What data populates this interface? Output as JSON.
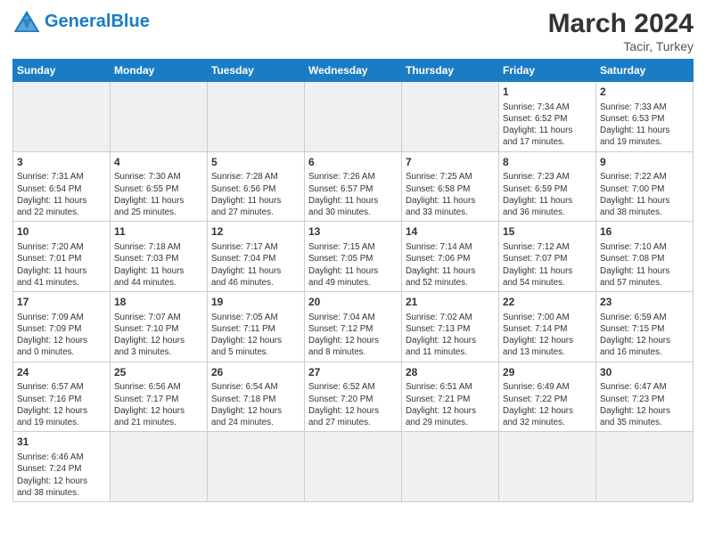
{
  "header": {
    "logo_general": "General",
    "logo_blue": "Blue",
    "month_year": "March 2024",
    "location": "Tacir, Turkey"
  },
  "weekdays": [
    "Sunday",
    "Monday",
    "Tuesday",
    "Wednesday",
    "Thursday",
    "Friday",
    "Saturday"
  ],
  "weeks": [
    [
      {
        "day": "",
        "info": ""
      },
      {
        "day": "",
        "info": ""
      },
      {
        "day": "",
        "info": ""
      },
      {
        "day": "",
        "info": ""
      },
      {
        "day": "",
        "info": ""
      },
      {
        "day": "1",
        "info": "Sunrise: 7:34 AM\nSunset: 6:52 PM\nDaylight: 11 hours\nand 17 minutes."
      },
      {
        "day": "2",
        "info": "Sunrise: 7:33 AM\nSunset: 6:53 PM\nDaylight: 11 hours\nand 19 minutes."
      }
    ],
    [
      {
        "day": "3",
        "info": "Sunrise: 7:31 AM\nSunset: 6:54 PM\nDaylight: 11 hours\nand 22 minutes."
      },
      {
        "day": "4",
        "info": "Sunrise: 7:30 AM\nSunset: 6:55 PM\nDaylight: 11 hours\nand 25 minutes."
      },
      {
        "day": "5",
        "info": "Sunrise: 7:28 AM\nSunset: 6:56 PM\nDaylight: 11 hours\nand 27 minutes."
      },
      {
        "day": "6",
        "info": "Sunrise: 7:26 AM\nSunset: 6:57 PM\nDaylight: 11 hours\nand 30 minutes."
      },
      {
        "day": "7",
        "info": "Sunrise: 7:25 AM\nSunset: 6:58 PM\nDaylight: 11 hours\nand 33 minutes."
      },
      {
        "day": "8",
        "info": "Sunrise: 7:23 AM\nSunset: 6:59 PM\nDaylight: 11 hours\nand 36 minutes."
      },
      {
        "day": "9",
        "info": "Sunrise: 7:22 AM\nSunset: 7:00 PM\nDaylight: 11 hours\nand 38 minutes."
      }
    ],
    [
      {
        "day": "10",
        "info": "Sunrise: 7:20 AM\nSunset: 7:01 PM\nDaylight: 11 hours\nand 41 minutes."
      },
      {
        "day": "11",
        "info": "Sunrise: 7:18 AM\nSunset: 7:03 PM\nDaylight: 11 hours\nand 44 minutes."
      },
      {
        "day": "12",
        "info": "Sunrise: 7:17 AM\nSunset: 7:04 PM\nDaylight: 11 hours\nand 46 minutes."
      },
      {
        "day": "13",
        "info": "Sunrise: 7:15 AM\nSunset: 7:05 PM\nDaylight: 11 hours\nand 49 minutes."
      },
      {
        "day": "14",
        "info": "Sunrise: 7:14 AM\nSunset: 7:06 PM\nDaylight: 11 hours\nand 52 minutes."
      },
      {
        "day": "15",
        "info": "Sunrise: 7:12 AM\nSunset: 7:07 PM\nDaylight: 11 hours\nand 54 minutes."
      },
      {
        "day": "16",
        "info": "Sunrise: 7:10 AM\nSunset: 7:08 PM\nDaylight: 11 hours\nand 57 minutes."
      }
    ],
    [
      {
        "day": "17",
        "info": "Sunrise: 7:09 AM\nSunset: 7:09 PM\nDaylight: 12 hours\nand 0 minutes."
      },
      {
        "day": "18",
        "info": "Sunrise: 7:07 AM\nSunset: 7:10 PM\nDaylight: 12 hours\nand 3 minutes."
      },
      {
        "day": "19",
        "info": "Sunrise: 7:05 AM\nSunset: 7:11 PM\nDaylight: 12 hours\nand 5 minutes."
      },
      {
        "day": "20",
        "info": "Sunrise: 7:04 AM\nSunset: 7:12 PM\nDaylight: 12 hours\nand 8 minutes."
      },
      {
        "day": "21",
        "info": "Sunrise: 7:02 AM\nSunset: 7:13 PM\nDaylight: 12 hours\nand 11 minutes."
      },
      {
        "day": "22",
        "info": "Sunrise: 7:00 AM\nSunset: 7:14 PM\nDaylight: 12 hours\nand 13 minutes."
      },
      {
        "day": "23",
        "info": "Sunrise: 6:59 AM\nSunset: 7:15 PM\nDaylight: 12 hours\nand 16 minutes."
      }
    ],
    [
      {
        "day": "24",
        "info": "Sunrise: 6:57 AM\nSunset: 7:16 PM\nDaylight: 12 hours\nand 19 minutes."
      },
      {
        "day": "25",
        "info": "Sunrise: 6:56 AM\nSunset: 7:17 PM\nDaylight: 12 hours\nand 21 minutes."
      },
      {
        "day": "26",
        "info": "Sunrise: 6:54 AM\nSunset: 7:18 PM\nDaylight: 12 hours\nand 24 minutes."
      },
      {
        "day": "27",
        "info": "Sunrise: 6:52 AM\nSunset: 7:20 PM\nDaylight: 12 hours\nand 27 minutes."
      },
      {
        "day": "28",
        "info": "Sunrise: 6:51 AM\nSunset: 7:21 PM\nDaylight: 12 hours\nand 29 minutes."
      },
      {
        "day": "29",
        "info": "Sunrise: 6:49 AM\nSunset: 7:22 PM\nDaylight: 12 hours\nand 32 minutes."
      },
      {
        "day": "30",
        "info": "Sunrise: 6:47 AM\nSunset: 7:23 PM\nDaylight: 12 hours\nand 35 minutes."
      }
    ],
    [
      {
        "day": "31",
        "info": "Sunrise: 6:46 AM\nSunset: 7:24 PM\nDaylight: 12 hours\nand 38 minutes."
      },
      {
        "day": "",
        "info": ""
      },
      {
        "day": "",
        "info": ""
      },
      {
        "day": "",
        "info": ""
      },
      {
        "day": "",
        "info": ""
      },
      {
        "day": "",
        "info": ""
      },
      {
        "day": "",
        "info": ""
      }
    ]
  ]
}
